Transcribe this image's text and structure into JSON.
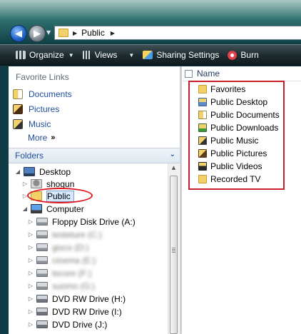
{
  "address_bar": {
    "path": [
      "Public"
    ]
  },
  "toolbar": {
    "organize": "Organize",
    "views": "Views",
    "sharing": "Sharing Settings",
    "burn": "Burn"
  },
  "favorite_links": {
    "heading": "Favorite Links",
    "items": [
      {
        "label": "Documents",
        "icon": "documents-icon"
      },
      {
        "label": "Pictures",
        "icon": "pictures-icon"
      },
      {
        "label": "Music",
        "icon": "music-icon"
      }
    ],
    "more": "More",
    "more_glyph": "»"
  },
  "folders": {
    "label": "Folders",
    "tree": [
      {
        "label": "Desktop",
        "icon": "desktop-icon",
        "expander": "expanded"
      },
      {
        "label": "shogun",
        "icon": "user-folder-icon",
        "expander": "collapsed"
      },
      {
        "label": "Public",
        "icon": "folder-icon",
        "expander": "collapsed",
        "selected": true
      },
      {
        "label": "Computer",
        "icon": "computer-icon",
        "expander": "expanded"
      },
      {
        "label": "Floppy Disk Drive (A:)",
        "icon": "floppy-drive-icon",
        "expander": "collapsed"
      },
      {
        "label": "testeture (C:)",
        "icon": "hard-drive-icon",
        "expander": "collapsed",
        "blurred": true
      },
      {
        "label": "gisco (D:)",
        "icon": "hard-drive-icon",
        "expander": "collapsed",
        "blurred": true
      },
      {
        "label": "cinema (E:)",
        "icon": "hard-drive-icon",
        "expander": "collapsed",
        "blurred": true
      },
      {
        "label": "tecore (F:)",
        "icon": "hard-drive-icon",
        "expander": "collapsed",
        "blurred": true
      },
      {
        "label": "suomo (G:)",
        "icon": "hard-drive-icon",
        "expander": "collapsed",
        "blurred": true
      },
      {
        "label": "DVD RW Drive (H:)",
        "icon": "dvd-drive-icon",
        "expander": "collapsed"
      },
      {
        "label": "DVD RW Drive (I:)",
        "icon": "dvd-drive-icon",
        "expander": "collapsed"
      },
      {
        "label": "DVD Drive (J:)",
        "icon": "dvd-drive-icon",
        "expander": "collapsed"
      }
    ]
  },
  "file_list": {
    "column_name": "Name",
    "items": [
      {
        "label": "Favorites",
        "icon": "favorites-folder-icon"
      },
      {
        "label": "Public Desktop",
        "icon": "desktop-folder-icon"
      },
      {
        "label": "Public Documents",
        "icon": "documents-folder-icon"
      },
      {
        "label": "Public Downloads",
        "icon": "downloads-folder-icon"
      },
      {
        "label": "Public Music",
        "icon": "music-folder-icon"
      },
      {
        "label": "Public Pictures",
        "icon": "pictures-folder-icon"
      },
      {
        "label": "Public Videos",
        "icon": "videos-folder-icon"
      },
      {
        "label": "Recorded TV",
        "icon": "recorded-tv-folder-icon"
      }
    ]
  },
  "colors": {
    "annotation_red": "#e0151d",
    "link_blue": "#1e4e9c",
    "selected_bg": "#d6e9ff"
  }
}
